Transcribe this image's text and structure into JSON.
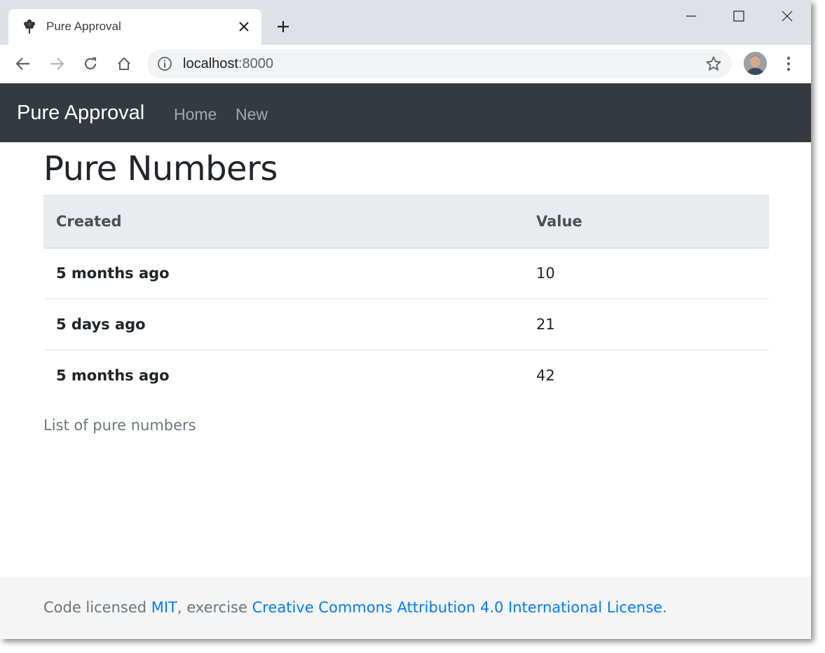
{
  "browser": {
    "tab_title": "Pure Approval",
    "url_host": "localhost",
    "url_port": ":8000"
  },
  "navbar": {
    "brand": "Pure Approval",
    "links": [
      "Home",
      "New"
    ]
  },
  "main": {
    "title": "Pure Numbers",
    "table": {
      "headers": [
        "Created",
        "Value"
      ],
      "rows": [
        {
          "created": "5 months ago",
          "value": "10"
        },
        {
          "created": "5 days ago",
          "value": "21"
        },
        {
          "created": "5 months ago",
          "value": "42"
        }
      ]
    },
    "caption": "List of pure numbers"
  },
  "footer": {
    "prefix": "Code licensed ",
    "mit_link": "MIT",
    "middle": ", exercise ",
    "cc_link": "Creative Commons Attribution 4.0 International License",
    "suffix": "."
  },
  "colors": {
    "navbar_bg": "#343a40",
    "link": "#007bff",
    "table_header_bg": "#e9ecef"
  }
}
